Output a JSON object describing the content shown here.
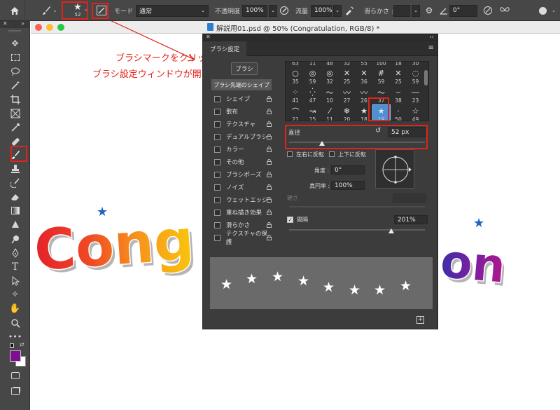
{
  "options_bar": {
    "brush_size": "52",
    "mode_label": "モード :",
    "mode_value": "通常",
    "opacity_label": "不透明度 :",
    "opacity_value": "100%",
    "flow_label": "流量 :",
    "flow_value": "100%",
    "smoothing_label": "滑らかさ :",
    "angle_value": "0°"
  },
  "document": {
    "title": "解説用01.psd @ 50% (Congratulation, RGB/8) *",
    "canvas_text_left": "Cong",
    "canvas_text_right": "on"
  },
  "annotation": {
    "line1": "ブラシマークをクリックすると",
    "line2": "ブラシ設定ウィンドウが開きます"
  },
  "panel": {
    "tab_title": "ブラシ設定",
    "brush_button": "ブラシ",
    "tip_shape_label": "ブラシ先端のシェイプ",
    "options": [
      {
        "label": "シェイプ"
      },
      {
        "label": "散布"
      },
      {
        "label": "テクスチャ"
      },
      {
        "label": "デュアルブラシ"
      },
      {
        "label": "カラー"
      },
      {
        "label": "その他"
      },
      {
        "label": "ブラシポーズ"
      },
      {
        "label": "ノイズ"
      },
      {
        "label": "ウェットエッジ"
      },
      {
        "label": "重ね描き効果"
      },
      {
        "label": "滑らかさ"
      },
      {
        "label": "テクスチャの保護"
      }
    ],
    "brush_grid": {
      "top_numbers": [
        "63",
        "11",
        "48",
        "32",
        "55",
        "100",
        "18",
        "30"
      ],
      "rows": [
        [
          {
            "n": "35",
            "g": "○"
          },
          {
            "n": "59",
            "g": "◎"
          },
          {
            "n": "32",
            "g": "◎"
          },
          {
            "n": "25",
            "g": "✕"
          },
          {
            "n": "36",
            "g": "✕"
          },
          {
            "n": "59",
            "g": "#"
          },
          {
            "n": "25",
            "g": "✕"
          },
          {
            "n": "59",
            "g": "◌"
          }
        ],
        [
          {
            "n": "41",
            "g": "⁘"
          },
          {
            "n": "47",
            "g": "⁛"
          },
          {
            "n": "10",
            "g": "～"
          },
          {
            "n": "27",
            "g": "〰"
          },
          {
            "n": "26",
            "g": "〰"
          },
          {
            "n": "37",
            "g": "〜"
          },
          {
            "n": "38",
            "g": "‒"
          },
          {
            "n": "23",
            "g": "―"
          }
        ],
        [
          {
            "n": "21",
            "g": "⌒"
          },
          {
            "n": "15",
            "g": "↝"
          },
          {
            "n": "11",
            "g": "⁄"
          },
          {
            "n": "20",
            "g": "❄"
          },
          {
            "n": "18",
            "g": "★"
          },
          {
            "n": "19",
            "g": "★"
          },
          {
            "n": "50",
            "g": "·"
          },
          {
            "n": "49",
            "g": "☆"
          }
        ]
      ]
    },
    "size_label": "直径",
    "size_value": "52 px",
    "flip_x_label": "左右に反転",
    "flip_y_label": "上下に反転",
    "angle_label": "角度 :",
    "angle_value": "0°",
    "roundness_label": "真円率 :",
    "roundness_value": "100%",
    "hardness_label": "硬さ",
    "spacing_label": "間隔",
    "spacing_value": "201%"
  },
  "colors": {
    "foreground": "#7c1090",
    "accent_red": "#e2231a"
  }
}
